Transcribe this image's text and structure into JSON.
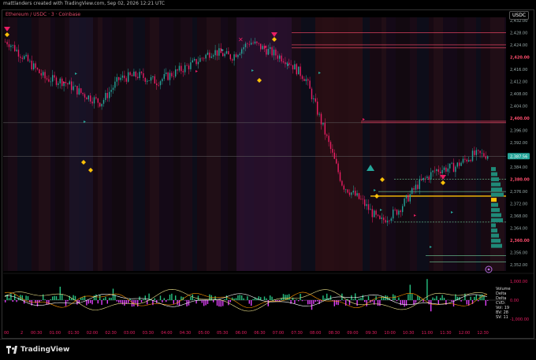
{
  "header": {
    "attribution": "mattlanders created with TradingView.com, Sep 02, 2026 12:21 UTC"
  },
  "symbol": {
    "label": "Ethereum / USDC · 3 · Coinbase",
    "currency": "USDC"
  },
  "footer": {
    "brand": "TradingView"
  },
  "volume_legend": [
    "Volume",
    "Delta",
    "Delta",
    "CVD:",
    "Vol: 19",
    "BV: 28",
    "SV: 11"
  ],
  "colors": {
    "up": "#26a69a",
    "down": "#e91e63",
    "level": "#ff4d6d",
    "marker": "#ffc107",
    "background": "#000000",
    "session_bg": "#1a0a14",
    "last_price": "#26a69a"
  },
  "icons": [
    "tradingview-logo-icon",
    "target-icon",
    "cross-icon",
    "triangle-down-icon",
    "triangle-up-icon",
    "diamond-icon"
  ],
  "chart_data": [
    {
      "type": "line",
      "title": "",
      "price_ticks": [
        "2,432.00",
        "2,428.00",
        "2,424.00",
        "2,420.00",
        "2,416.00",
        "2,412.00",
        "2,408.00",
        "2,404.00",
        "2,400.00",
        "2,396.00",
        "2,392.00",
        "2,387.56",
        "2,384.00",
        "2,380.00",
        "2,376.00",
        "2,372.00",
        "2,368.00",
        "2,364.00",
        "2,360.00",
        "2,356.00",
        "2,352.00"
      ],
      "highlight_ticks": [
        "2,420.00",
        "2,400.00",
        "2,380.00",
        "2,360.00"
      ],
      "last_price": 2387.56,
      "ylim": [
        2350,
        2433
      ],
      "time_ticks": [
        "00:30",
        "01:00",
        "01:30",
        "02:00",
        "02:30",
        "03:00",
        "03:30",
        "04:00",
        "04:30",
        "05:00",
        "05:30",
        "06:00",
        "06:30",
        "07:00",
        "07:30",
        "08:00",
        "08:30",
        "09:00",
        "09:30",
        "10:00",
        "10:30",
        "11:00",
        "11:30",
        "12:00",
        "12:30"
      ],
      "time_ticks_partial": [
        "00",
        "2"
      ],
      "x": [
        "00:00",
        "00:30",
        "01:00",
        "01:30",
        "02:00",
        "02:30",
        "03:00",
        "03:30",
        "04:00",
        "04:30",
        "05:00",
        "05:30",
        "06:00",
        "06:30",
        "07:00",
        "07:30",
        "08:00",
        "08:30",
        "09:00",
        "09:30",
        "10:00",
        "10:30",
        "11:00",
        "11:30",
        "12:00",
        "12:30"
      ],
      "series": [
        {
          "values": [
            2425,
            2419,
            2413,
            2412,
            2408,
            2405,
            2413,
            2414,
            2412,
            2415,
            2418,
            2422,
            2420,
            2425,
            2422,
            2419,
            2413,
            2396,
            2378,
            2373,
            2366,
            2370,
            2378,
            2383,
            2384,
            2388
          ]
        }
      ],
      "resistance_levels": [
        2428,
        2424,
        2423,
        2399,
        2398.5
      ],
      "support_levels": [
        2380,
        2376,
        2374.5,
        2366,
        2355,
        2353
      ]
    },
    {
      "type": "bar",
      "title": "",
      "y_ticks": [
        "1,000.00",
        "0.00",
        "-1,000.00"
      ],
      "ylim": [
        -1300,
        1300
      ]
    }
  ]
}
